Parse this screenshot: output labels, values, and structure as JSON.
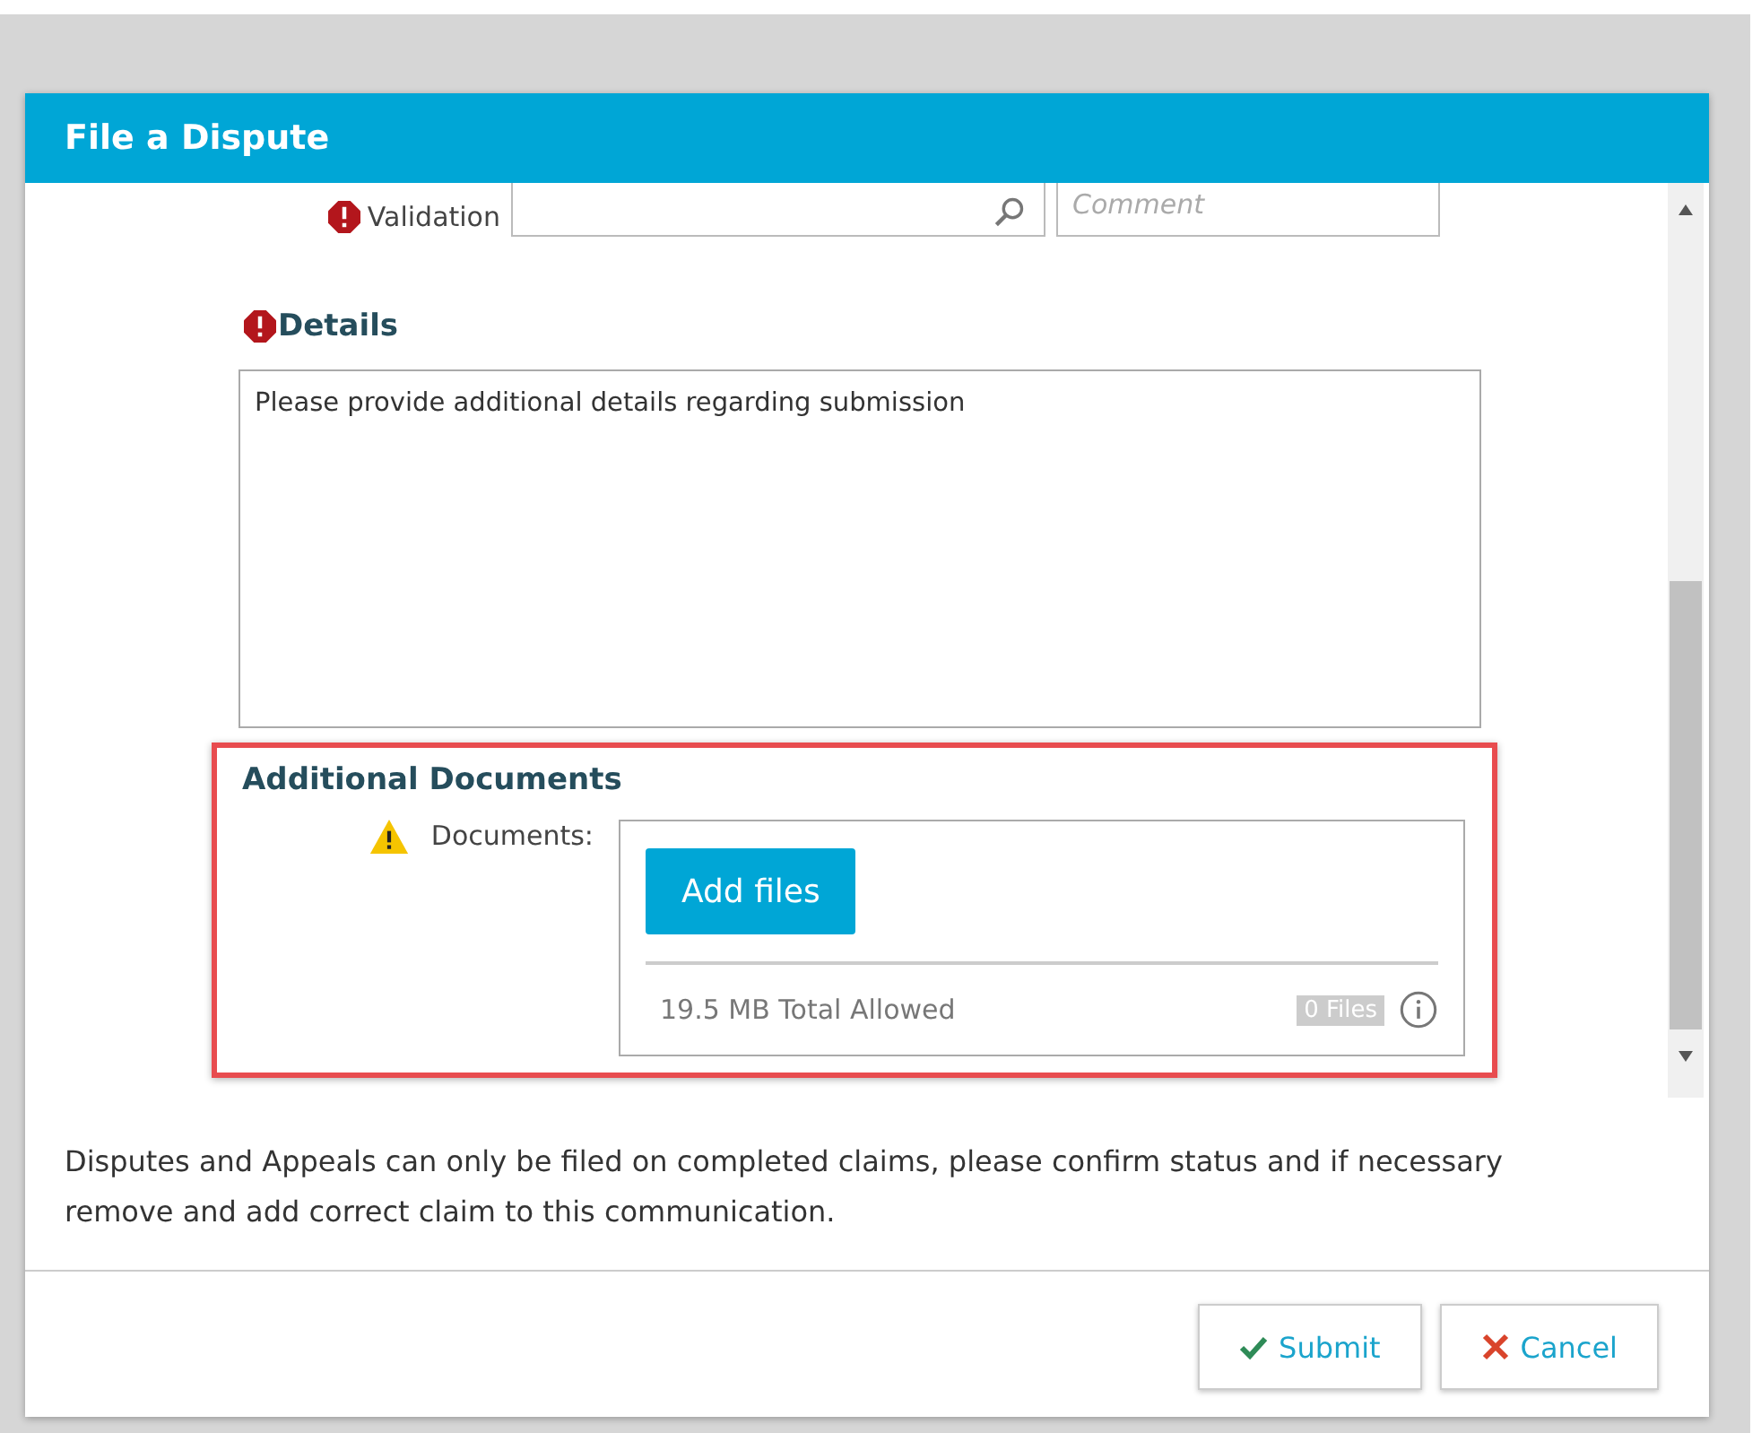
{
  "dialog": {
    "title": "File a Dispute"
  },
  "validation": {
    "label": "Validation",
    "required": true,
    "comment_placeholder": "Comment"
  },
  "details": {
    "label": "Details",
    "required": true,
    "value": "Please provide additional details regarding submission"
  },
  "additional_documents": {
    "heading": "Additional Documents",
    "highlighted": true,
    "label": "Documents:",
    "warning": true,
    "add_button": "Add files",
    "limit": "19.5 MB Total Allowed",
    "count": "0 Files"
  },
  "notice": "Disputes and Appeals can only be filed on completed claims, please confirm status and if necessary remove and add correct claim to this communication.",
  "buttons": [
    {
      "kind": "submit",
      "label": "Submit"
    },
    {
      "kind": "cancel",
      "label": "Cancel"
    }
  ]
}
